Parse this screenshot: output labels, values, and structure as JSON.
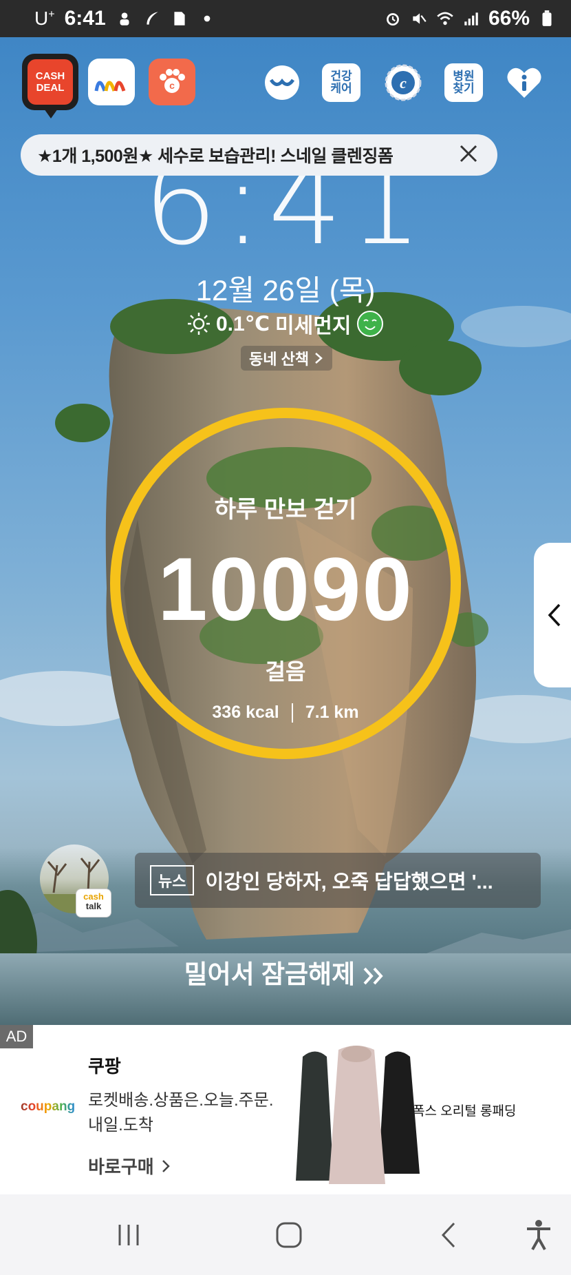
{
  "status_bar": {
    "carrier": "U",
    "carrier_sup": "+",
    "time": "6:41",
    "battery": "66%"
  },
  "top_icons": {
    "cashdeal_line1": "CASH",
    "cashdeal_line2": "DEAL",
    "health_line1": "건강",
    "health_line2": "케어",
    "hospital_line1": "병원",
    "hospital_line2": "찾기"
  },
  "promo_banner": {
    "text": "★1개 1,500원★ 세수로 보습관리! 스네일 클렌징폼"
  },
  "lockscreen": {
    "clock": "6:41",
    "date": "12월 26일 (목)",
    "temperature": "0.1℃",
    "dust_label": "미세먼지",
    "walk_link": "동네 산책"
  },
  "steps": {
    "title": "하루 만보 걷기",
    "count": "10090",
    "unit": "걸음",
    "kcal": "336 kcal",
    "distance": "7.1 km"
  },
  "news": {
    "tag": "뉴스",
    "headline": "이강인 당하자, 오죽 답답했으면 '...",
    "cashtalk_line1": "cash",
    "cashtalk_line2": "talk"
  },
  "unlock_text": "밀어서 잠금해제",
  "ad": {
    "badge": "AD",
    "logo": "coupang",
    "title": "쿠팡",
    "desc": "로켓배송.상품은.오늘.주문.내일.도착",
    "cta": "바로구매",
    "product": "폭스 오리털 롱패딩"
  },
  "colors": {
    "ring": "#f6c21a",
    "cashdeal": "#e8452c",
    "pet": "#f26a4b",
    "dust_good": "#3fb24a"
  }
}
